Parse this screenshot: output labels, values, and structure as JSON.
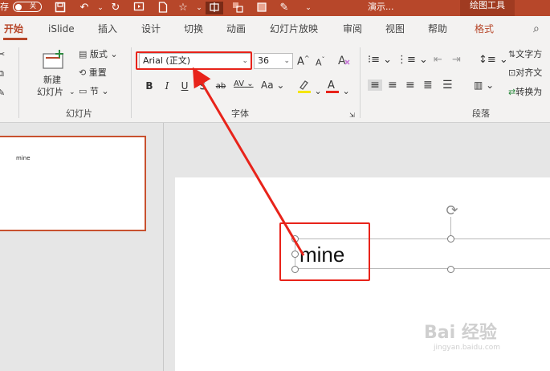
{
  "titlebar": {
    "autosave_label": "存",
    "autosave_state": "关",
    "doc_title": "演示...",
    "context_tab_title": "绘图工具"
  },
  "tabs": [
    {
      "label": "开始"
    },
    {
      "label": "iSlide"
    },
    {
      "label": "插入"
    },
    {
      "label": "设计"
    },
    {
      "label": "切换"
    },
    {
      "label": "动画"
    },
    {
      "label": "幻灯片放映"
    },
    {
      "label": "审阅"
    },
    {
      "label": "视图"
    },
    {
      "label": "帮助"
    },
    {
      "label": "格式"
    }
  ],
  "ribbon": {
    "slides": {
      "new_slide_line1": "新建",
      "new_slide_line2": "幻灯片",
      "layout": "版式",
      "reset": "重置",
      "section": "节",
      "group_label": "幻灯片"
    },
    "font": {
      "font_name": "Arial (正文)",
      "font_size": "36",
      "bold": "B",
      "italic": "I",
      "underline": "U",
      "shadow": "S",
      "strike": "ab",
      "spacing": "AV",
      "case": "Aa",
      "grow": "A",
      "shrink": "A",
      "group_label": "字体",
      "font_color": "#e8231a",
      "highlight_color": "#f5e600"
    },
    "paragraph": {
      "text_direction": "文字方",
      "align_text": "对齐文",
      "convert": "转换为",
      "group_label": "段落"
    }
  },
  "thumbnail": {
    "text": "mine"
  },
  "slide": {
    "text": "mine"
  },
  "watermark": {
    "main": "Bai 经验",
    "sub": "jingyan.baidu.com"
  },
  "colors": {
    "accent": "#b7472a",
    "annotation": "#e8231a"
  }
}
